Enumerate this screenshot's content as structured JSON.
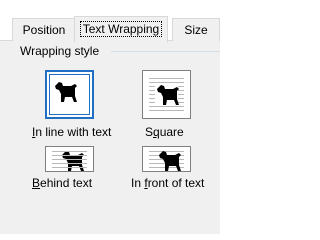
{
  "tabs": [
    {
      "label": "Position",
      "active": false
    },
    {
      "label": "Text Wrapping",
      "active": true
    },
    {
      "label": "Size",
      "active": false
    }
  ],
  "wrapping_style": {
    "label": "Wrapping style",
    "options": [
      {
        "label": "In line with text",
        "mnemonic": "I",
        "rest": "n line with text",
        "icon": "wrap-inline-icon",
        "selected": true
      },
      {
        "label": "Square",
        "mnemonic": "q",
        "pre": "S",
        "rest": "uare",
        "icon": "wrap-square-icon",
        "selected": false
      },
      {
        "label": "Behind text",
        "mnemonic": "B",
        "rest": "ehind text",
        "icon": "wrap-behind-icon",
        "selected": false
      },
      {
        "label": "In front of text",
        "mnemonic": "f",
        "pre": "In ",
        "rest": "ront of text",
        "icon": "wrap-front-icon",
        "selected": false
      }
    ]
  },
  "colors": {
    "selected_border": "#1f6fc5",
    "dog": "#000000",
    "text_lines": "#b8b8b8"
  }
}
